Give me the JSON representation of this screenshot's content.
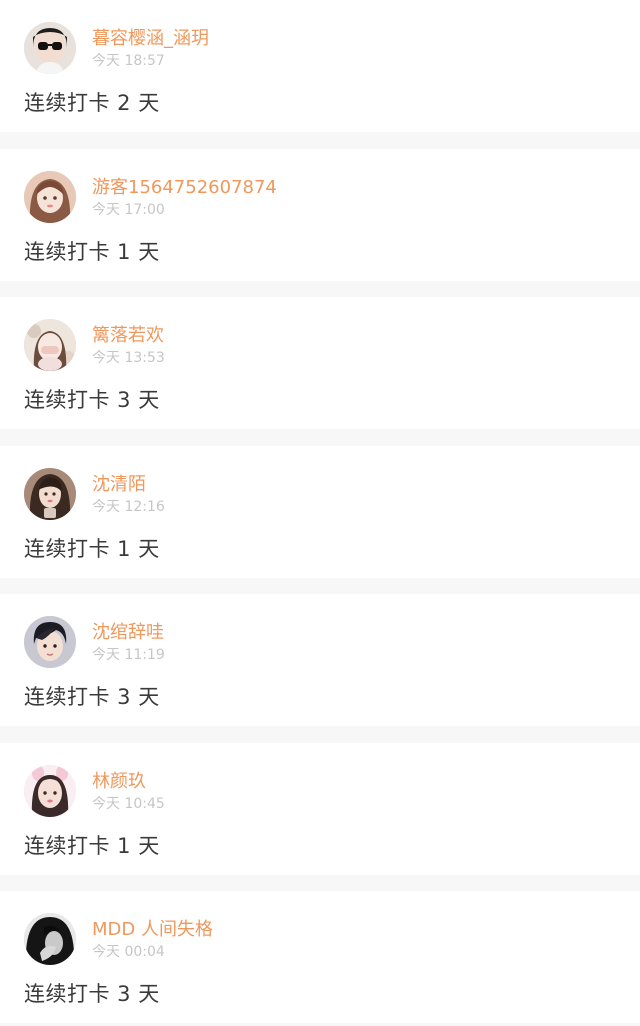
{
  "posts": [
    {
      "username": "暮容樱涵_涵玥",
      "time": "今天 18:57",
      "checkin": "连续打卡 2 天",
      "avatar_icon": "avatar-icon",
      "avatar_colors": [
        "#2b2b2b",
        "#f3dcd0",
        "#111111"
      ]
    },
    {
      "username": "游客1564752607874",
      "time": "今天 17:00",
      "checkin": "连续打卡 1 天",
      "avatar_icon": "avatar-icon",
      "avatar_colors": [
        "#caa08a",
        "#f6e3d8",
        "#7a4a36"
      ]
    },
    {
      "username": "篱落若欢",
      "time": "今天 13:53",
      "checkin": "连续打卡 3 天",
      "avatar_icon": "avatar-icon",
      "avatar_colors": [
        "#e9ddd3",
        "#f7e9e2",
        "#d99a9a"
      ]
    },
    {
      "username": "沈清陌",
      "time": "今天 12:16",
      "checkin": "连续打卡 1 天",
      "avatar_icon": "avatar-icon",
      "avatar_colors": [
        "#6a4a3c",
        "#f2dccf",
        "#2d1f18"
      ]
    },
    {
      "username": "沈绾辞哇",
      "time": "今天 11:19",
      "checkin": "连续打卡 3 天",
      "avatar_icon": "avatar-icon",
      "avatar_colors": [
        "#b8b8c4",
        "#f4dfd3",
        "#1c1a22"
      ]
    },
    {
      "username": "林颜玖",
      "time": "今天 10:45",
      "checkin": "连续打卡 1 天",
      "avatar_icon": "avatar-icon",
      "avatar_colors": [
        "#f7e3ea",
        "#f6dfd6",
        "#3a2a2a"
      ]
    },
    {
      "username": "MDD 人间失格",
      "time": "今天 00:04",
      "checkin": "连续打卡 3 天",
      "avatar_icon": "avatar-icon",
      "avatar_colors": [
        "#e4e4e4",
        "#bdbdbd",
        "#111111"
      ]
    }
  ],
  "colors": {
    "username": "#f0985c",
    "timestamp": "#c6c6c6",
    "checkin_text": "#3a3a3a",
    "separator": "#f7f7f7",
    "card_bg": "#ffffff"
  }
}
